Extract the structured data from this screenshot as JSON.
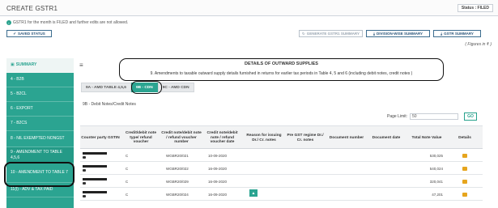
{
  "header": {
    "title": "CREATE GSTR1",
    "status_label": "Status : FILED"
  },
  "notice": {
    "icon": "info-icon",
    "text": "GSTR1 for the month is FILED and further edits are not allowed."
  },
  "toolbar": {
    "saved_status": "SAVED STATUS",
    "generate_summary": "GENERATE GSTR1 SUMMARY",
    "division_summary": "DIVISION-WISE SUMMARY",
    "gstr1_summary": "GSTR SUMMARY",
    "figures_note": "( Figures in ₹ )"
  },
  "sidebar": {
    "items": [
      {
        "label": "SUMMARY"
      },
      {
        "label": "4 - B2B"
      },
      {
        "label": "5 - B2CL"
      },
      {
        "label": "6 - EXPORT"
      },
      {
        "label": "7 - B2CS"
      },
      {
        "label": "8 - NIL EXEMPTED NONGST"
      },
      {
        "label": "9 - AMENDMENT TO TABLE 4,5,6"
      },
      {
        "label": "10 - AMENDMENT TO TABLE 7"
      },
      {
        "label": "11(I) - ADV & TAX PAID"
      }
    ]
  },
  "details": {
    "title": "DETAILS OF OUTWARD SUPPLIES",
    "description": "9. Amendments to taxable outward supply details furnished in returns for earlier tax periods in Table 4, 5 and 6 (including debit notes, credit notes )"
  },
  "tabs": [
    {
      "label": "9A - AMD TABLE 4,5,6"
    },
    {
      "label": "9B - CDN"
    },
    {
      "label": "9C - AMD CDN"
    }
  ],
  "section": {
    "label": "9B - Debit Notes/Credit Notes"
  },
  "pagination": {
    "label": "Page Limit:",
    "value": "50",
    "go": "GO"
  },
  "table": {
    "headers": [
      "Counter party GSTIN",
      "Credit/debit note type/ refund voucher",
      "Credit note/debit note / refund voucher number",
      "Credit note/debit note / refund voucher date",
      "Reason for issuing Dr./ Cr. notes",
      "Pre GST regime Dr./ Cr. notes",
      "Document number",
      "Document date",
      "Total Note Value",
      "Details"
    ],
    "rows": [
      {
        "type": "C",
        "number": "WGBR20/021",
        "date": "10-09-2020",
        "value": "530,025"
      },
      {
        "type": "C",
        "number": "WGBR20/022",
        "date": "16-09-2020",
        "value": "540,024"
      },
      {
        "type": "C",
        "number": "WGBR20/029",
        "date": "16-09-2020",
        "value": "320,041"
      },
      {
        "type": "C",
        "number": "WGBR20/024",
        "date": "16-09-2020",
        "value": "47,201"
      }
    ]
  },
  "colors": {
    "accent": "#2ba491",
    "button_border": "#3c6d8f",
    "edit_icon": "#e6a51d"
  }
}
